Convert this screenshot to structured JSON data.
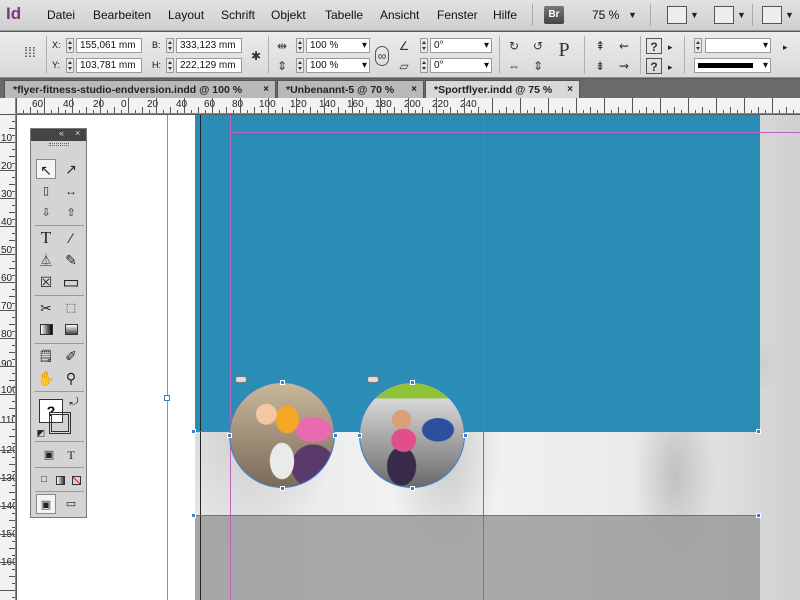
{
  "app": {
    "logo": "Id"
  },
  "menu": {
    "items": [
      "Datei",
      "Bearbeiten",
      "Layout",
      "Schrift",
      "Objekt",
      "Tabelle",
      "Ansicht",
      "Fenster",
      "Hilfe"
    ],
    "bridge_badge": "Br",
    "zoom": "75 %"
  },
  "control": {
    "x_label": "X:",
    "x_value": "155,061 mm",
    "y_label": "Y:",
    "y_value": "103,781 mm",
    "w_label": "B:",
    "w_value": "333,123 mm",
    "h_label": "H:",
    "h_value": "222,129 mm",
    "scale_x": "100 %",
    "scale_y": "100 %",
    "rotate": "0°",
    "shear": "0°",
    "p_label": "P",
    "help_label": "?",
    "stroke_swatch_color": "#000000"
  },
  "tabs": [
    {
      "label": "*flyer-fitness-studio-endversion.indd @ 100 %",
      "close": "×"
    },
    {
      "label": "*Unbenannt-5 @ 70 %",
      "close": "×"
    },
    {
      "label": "*Sportflyer.indd @ 75 %",
      "close": "×",
      "active": true
    }
  ],
  "ruler": {
    "h_labels": [
      "60",
      "40",
      "20",
      "0",
      "20",
      "40",
      "60",
      "80",
      "100",
      "120",
      "140",
      "160",
      "180",
      "200",
      "220",
      "240"
    ],
    "v_labels": [
      "10",
      "20",
      "30",
      "40",
      "50",
      "60",
      "70",
      "80",
      "90",
      "100",
      "110",
      "120",
      "130",
      "140",
      "150",
      "160"
    ]
  },
  "colors": {
    "blue_block": "#2a8db6",
    "guide_margin": "#c060c0",
    "guide_bleed": "#e05050",
    "guide_column": "#5aa0e0",
    "selection": "#3a7fd0"
  },
  "tools": [
    "selection-tool",
    "direct-selection-tool",
    "page-tool",
    "gap-tool",
    "content-collector-tool",
    "content-placer-tool",
    "type-tool",
    "line-tool",
    "pen-tool",
    "pencil-tool",
    "rectangle-frame-tool",
    "rectangle-tool",
    "scissors-tool",
    "free-transform-tool",
    "gradient-swatch-tool",
    "gradient-feather-tool",
    "note-tool",
    "eyedropper-tool",
    "hand-tool",
    "zoom-tool",
    "fill-stroke-swatch",
    "formatting-container",
    "formatting-text",
    "apply-color",
    "apply-gradient",
    "apply-none",
    "normal-view-mode",
    "screen-mode"
  ],
  "tools_glyphs": {
    "selection": "↖",
    "direct": "↗",
    "type": "T",
    "line": "∕",
    "pen": "✠",
    "pencil": "✎",
    "frame": "☒",
    "rect": "▭",
    "scissors": "✂",
    "eyedropper": "✐",
    "hand": "✋",
    "zoom": "⚲",
    "help": "?"
  }
}
